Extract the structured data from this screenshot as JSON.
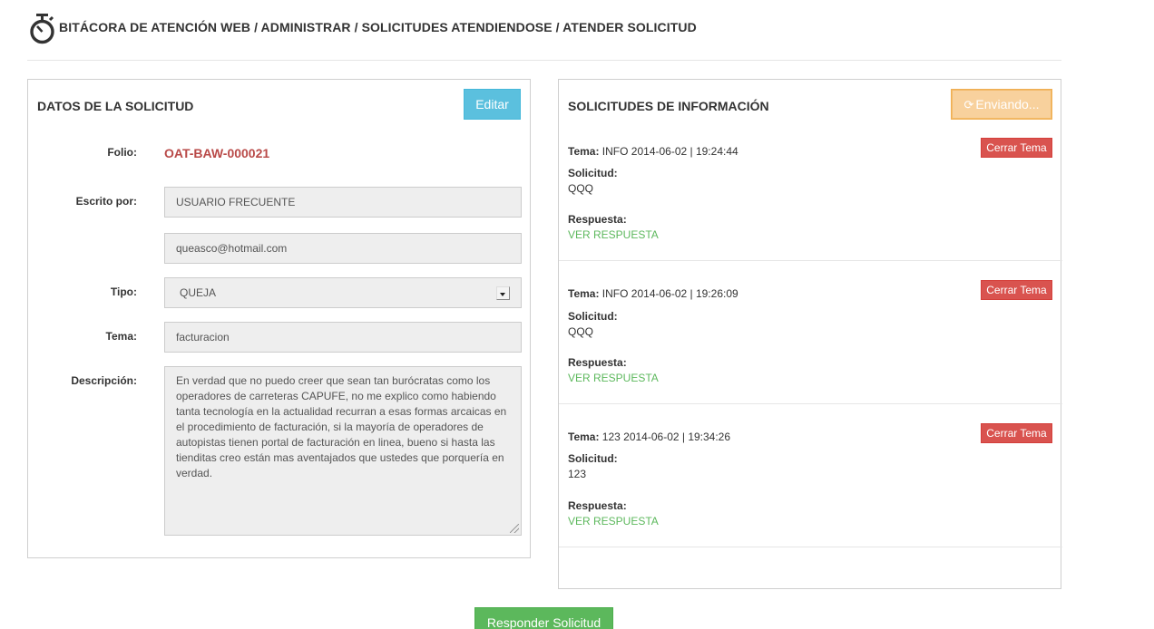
{
  "header": {
    "title": "BITÁCORA DE ATENCIÓN WEB / ADMINISTRAR / SOLICITUDES ATENDIENDOSE / ATENDER SOLICITUD",
    "icon": "stopwatch-icon"
  },
  "left_panel": {
    "title": "DATOS DE LA SOLICITUD",
    "edit_label": "Editar",
    "folio_label": "Folio:",
    "folio_value": "OAT-BAW-000021",
    "written_by_label": "Escrito por:",
    "written_by_value": "USUARIO FRECUENTE",
    "email_value": "queasco@hotmail.com",
    "type_label": "Tipo:",
    "type_value": "QUEJA",
    "topic_label": "Tema:",
    "topic_value": "facturacion",
    "description_label": "Descripción:",
    "description_value": "En verdad que no puedo creer que sean tan burócratas como los operadores de carreteras CAPUFE, no me explico como habiendo tanta tecnología en la actualidad recurran a esas formas arcaicas en el procedimiento de facturación, si la mayoría de operadores de autopistas tienen portal de facturación en linea, bueno si hasta las tienditas creo están mas aventajados que ustedes que porquería en verdad."
  },
  "right_panel": {
    "title": "SOLICITUDES DE INFORMACIÓN",
    "sending_label": "Enviando...",
    "items": [
      {
        "tema_label": "Tema:",
        "tema_value": "INFO 2014-06-02 | 19:24:44",
        "solicitud_label": "Solicitud:",
        "solicitud_value": "QQQ",
        "respuesta_label": "Respuesta:",
        "respuesta_link": "VER RESPUESTA",
        "close_label": "Cerrar Tema"
      },
      {
        "tema_label": "Tema:",
        "tema_value": "INFO 2014-06-02 | 19:26:09",
        "solicitud_label": "Solicitud:",
        "solicitud_value": "QQQ",
        "respuesta_label": "Respuesta:",
        "respuesta_link": "VER RESPUESTA",
        "close_label": "Cerrar Tema"
      },
      {
        "tema_label": "Tema:",
        "tema_value": "123 2014-06-02 | 19:34:26",
        "solicitud_label": "Solicitud:",
        "solicitud_value": "123",
        "respuesta_label": "Respuesta:",
        "respuesta_link": "VER RESPUESTA",
        "close_label": "Cerrar Tema"
      }
    ]
  },
  "footer": {
    "respond_label": "Responder Solicitud"
  },
  "colors": {
    "info": "#5bc0de",
    "warning": "#f0ad4e",
    "danger": "#d9534f",
    "success": "#5cb85c",
    "folio": "#b94a48"
  }
}
